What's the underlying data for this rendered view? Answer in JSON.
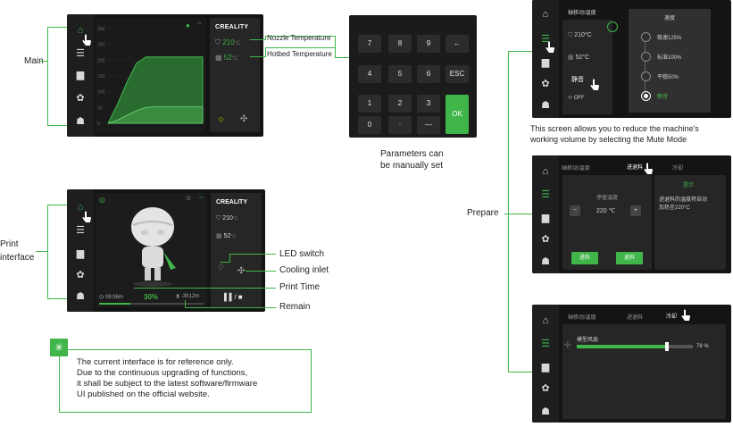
{
  "labels": {
    "main": "Main",
    "print_interface_line1": "Print",
    "print_interface_line2": "interface",
    "nozzle_temperature": "Nozzle Temperature",
    "hotbed_temperature": "Hotbed Temperature",
    "params_line1": "Parameters can",
    "params_line2": "be manually set",
    "mute_line1": "This screen allows you to reduce the machine's",
    "mute_line2": "working volume by selecting the Mute Mode",
    "prepare": "Prepare",
    "led_switch": "LED switch",
    "cooling_inlet": "Cooling inlet",
    "print_time": "Print Time",
    "remain": "Remain"
  },
  "note": {
    "line1": "The current interface is for reference only.",
    "line2": "Due to the continuous upgrading of functions,",
    "line3": "it shall be subject to the latest software/firmware",
    "line4": "UI published on the official website."
  },
  "main_screen": {
    "brand": "CREALITY",
    "nozzle": "210",
    "bed": "52",
    "unit": "°C",
    "y_ticks": [
      "300",
      "250",
      "200",
      "150",
      "100",
      "50",
      "0"
    ]
  },
  "print_screen": {
    "brand": "CREALITY",
    "nozzle": "210",
    "bed": "52",
    "unit": "°C",
    "elapsed": "08:56m",
    "progress_label": "30%",
    "progress": 0.3,
    "remain": "-3h12m",
    "control": "▌▌/ ■"
  },
  "keypad": {
    "keys": [
      "7",
      "8",
      "9",
      "←",
      "4",
      "5",
      "6",
      "ESC",
      "1",
      "2",
      "3",
      "0",
      "·",
      "—"
    ],
    "ok": "OK"
  },
  "mute_screen": {
    "tab": "轴移动/温度",
    "nozzle": "210°C",
    "bed": "52°C",
    "mute_btn": "静音",
    "off_label": "OFF",
    "speed_title": "速度",
    "options": [
      "极速125%",
      "标准100%",
      "平稳50%",
      "静音"
    ],
    "selected_index": 3
  },
  "feed_screen": {
    "tabs": [
      "轴移动/温度",
      "进退料",
      "冷却"
    ],
    "temp_label": "停留温度",
    "temp_value": "220 ℃",
    "minus": "−",
    "plus": "+",
    "btn1": "进料",
    "btn2": "退料",
    "hint_title": "提示",
    "hint_line1": "进退料的温度将自动",
    "hint_line2": "加热至220°C"
  },
  "cool_screen": {
    "tabs": [
      "轴移动/温度",
      "进退料",
      "冷却"
    ],
    "fan_label": "模型风扇",
    "fan_value": "78 %",
    "fan_level": 0.78
  },
  "colors": {
    "accent": "#3fb54a",
    "screen_bg": "#141414"
  }
}
